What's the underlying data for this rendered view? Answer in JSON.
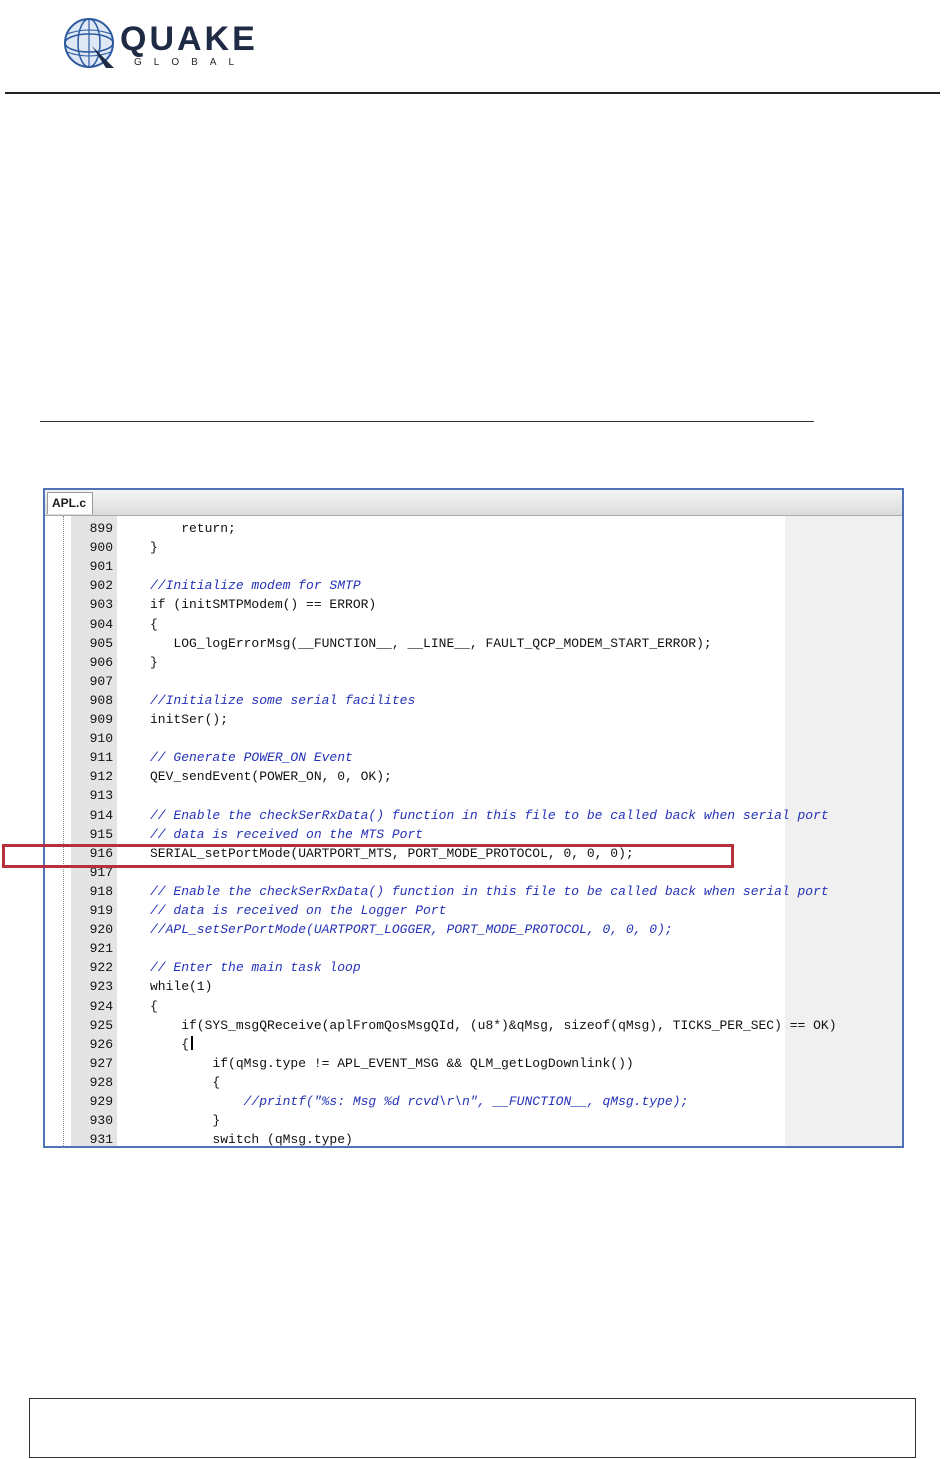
{
  "header": {
    "brand": "QUAKE",
    "sub": "GLOBAL",
    "colors": {
      "brand": "#1f2a44",
      "globe": "#2c5aa0"
    }
  },
  "editor": {
    "tab_label": "APL.c",
    "highlight_color": "#b52f3d",
    "highlighted_line": "916",
    "lines": [
      {
        "num": "899",
        "text": "    return;",
        "style": "normal"
      },
      {
        "num": "900",
        "text": "}",
        "style": "normal"
      },
      {
        "num": "901",
        "text": "",
        "style": "normal"
      },
      {
        "num": "902",
        "text": "//Initialize modem for SMTP",
        "style": "comment"
      },
      {
        "num": "903",
        "text": "if (initSMTPModem() == ERROR)",
        "style": "normal"
      },
      {
        "num": "904",
        "text": "{",
        "style": "normal"
      },
      {
        "num": "905",
        "text": "   LOG_logErrorMsg(__FUNCTION__, __LINE__, FAULT_QCP_MODEM_START_ERROR);",
        "style": "normal"
      },
      {
        "num": "906",
        "text": "}",
        "style": "normal"
      },
      {
        "num": "907",
        "text": "",
        "style": "normal"
      },
      {
        "num": "908",
        "text": "//Initialize some serial facilites",
        "style": "comment"
      },
      {
        "num": "909",
        "text": "initSer();",
        "style": "normal"
      },
      {
        "num": "910",
        "text": "",
        "style": "normal"
      },
      {
        "num": "911",
        "text": "// Generate POWER_ON Event",
        "style": "comment"
      },
      {
        "num": "912",
        "text": "QEV_sendEvent(POWER_ON, 0, OK);",
        "style": "normal"
      },
      {
        "num": "913",
        "text": "",
        "style": "normal"
      },
      {
        "num": "914",
        "text": "// Enable the checkSerRxData() function in this file to be called back when serial port",
        "style": "comment"
      },
      {
        "num": "915",
        "text": "// data is received on the MTS Port",
        "style": "comment"
      },
      {
        "num": "916",
        "text": "SERIAL_setPortMode(UARTPORT_MTS, PORT_MODE_PROTOCOL, 0, 0, 0);",
        "style": "normal"
      },
      {
        "num": "917",
        "text": "",
        "style": "normal"
      },
      {
        "num": "918",
        "text": "// Enable the checkSerRxData() function in this file to be called back when serial port",
        "style": "comment"
      },
      {
        "num": "919",
        "text": "// data is received on the Logger Port",
        "style": "comment"
      },
      {
        "num": "920",
        "text": "//APL_setSerPortMode(UARTPORT_LOGGER, PORT_MODE_PROTOCOL, 0, 0, 0);",
        "style": "comment"
      },
      {
        "num": "921",
        "text": "",
        "style": "normal"
      },
      {
        "num": "922",
        "text": "// Enter the main task loop",
        "style": "comment"
      },
      {
        "num": "923",
        "text": "while(1)",
        "style": "normal"
      },
      {
        "num": "924",
        "text": "{",
        "style": "normal"
      },
      {
        "num": "925",
        "text": "    if(SYS_msgQReceive(aplFromQosMsgQId, (u8*)&qMsg, sizeof(qMsg), TICKS_PER_SEC) == OK)",
        "style": "normal"
      },
      {
        "num": "926",
        "text": "    {",
        "style": "normal",
        "caret": true
      },
      {
        "num": "927",
        "text": "        if(qMsg.type != APL_EVENT_MSG && QLM_getLogDownlink())",
        "style": "normal"
      },
      {
        "num": "928",
        "text": "        {",
        "style": "normal"
      },
      {
        "num": "929",
        "text": "            //printf(\"%s: Msg %d rcvd\\r\\n\", __FUNCTION__, qMsg.type);",
        "style": "comment"
      },
      {
        "num": "930",
        "text": "        }",
        "style": "normal"
      },
      {
        "num": "931",
        "text": "        switch (qMsg.type)",
        "style": "normal"
      }
    ]
  }
}
